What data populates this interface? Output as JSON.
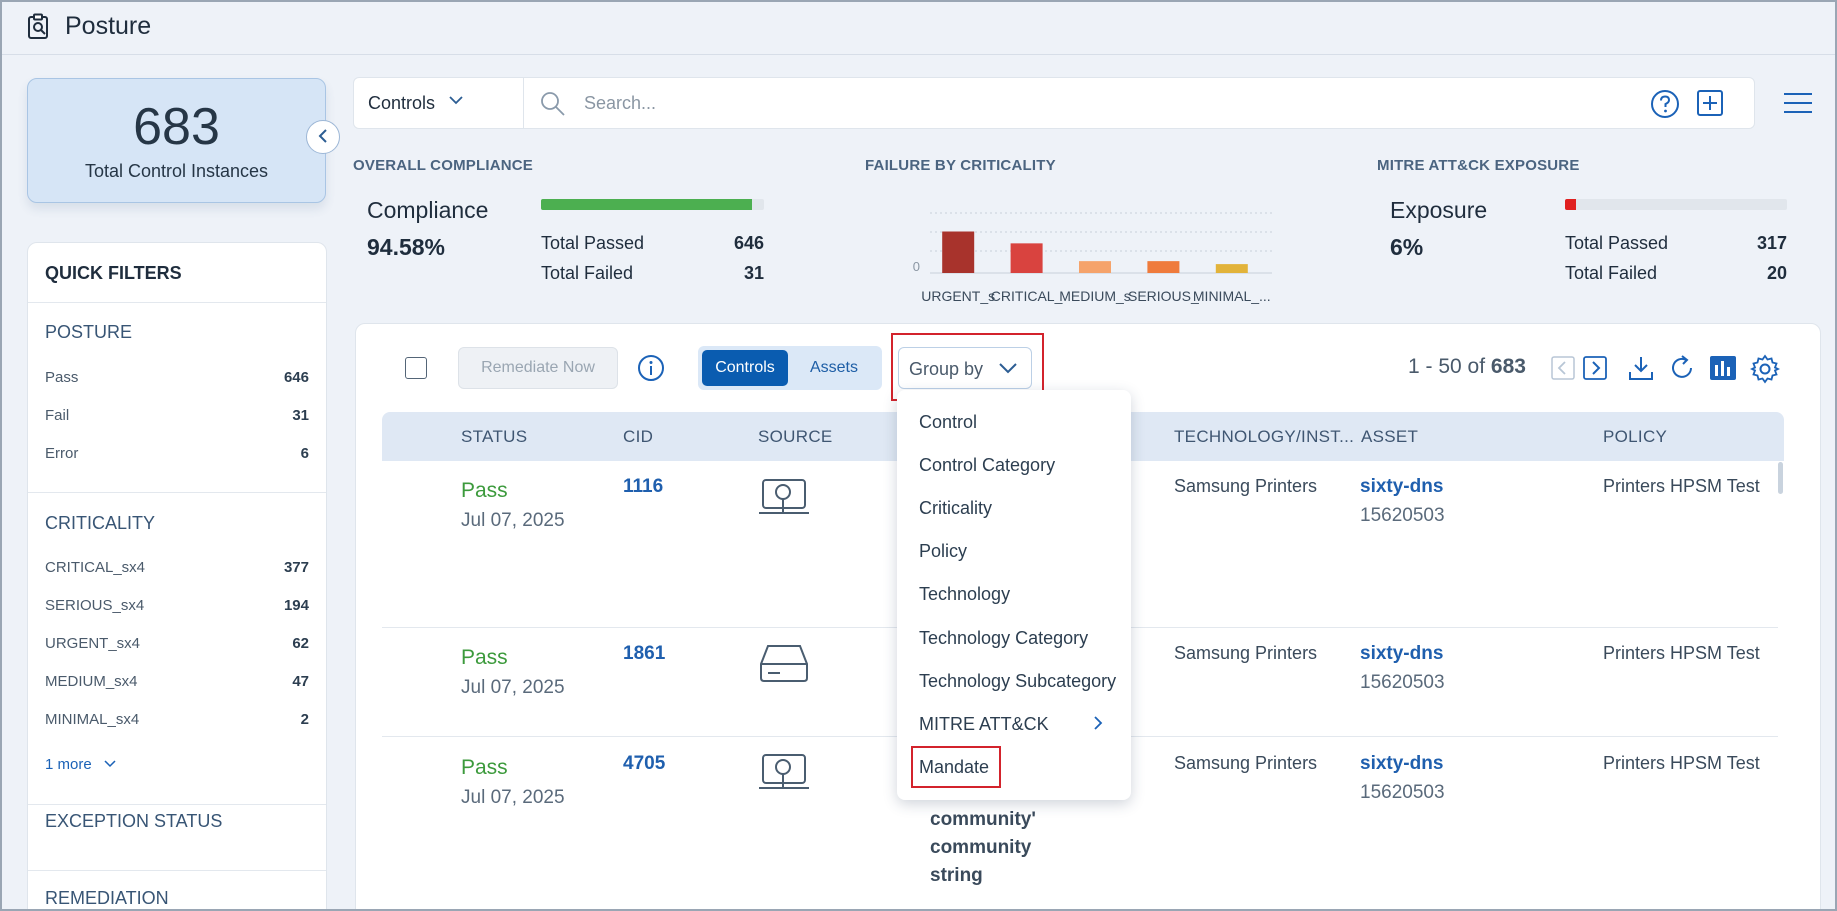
{
  "app": {
    "title": "Posture",
    "icon": "clipboard-search-icon"
  },
  "summary": {
    "total": "683",
    "label": "Total Control Instances"
  },
  "quick_filters": {
    "title": "QUICK FILTERS",
    "posture": {
      "title": "POSTURE",
      "items": [
        {
          "label": "Pass",
          "count": "646"
        },
        {
          "label": "Fail",
          "count": "31"
        },
        {
          "label": "Error",
          "count": "6"
        }
      ]
    },
    "criticality": {
      "title": "CRITICALITY",
      "items": [
        {
          "label": "CRITICAL_sx4",
          "count": "377"
        },
        {
          "label": "SERIOUS_sx4",
          "count": "194"
        },
        {
          "label": "URGENT_sx4",
          "count": "62"
        },
        {
          "label": "MEDIUM_sx4",
          "count": "47"
        },
        {
          "label": "MINIMAL_sx4",
          "count": "2"
        }
      ],
      "more": "1 more"
    },
    "exception_status": "EXCEPTION STATUS",
    "remediation": "REMEDIATION"
  },
  "search": {
    "scope": "Controls",
    "placeholder": "Search..."
  },
  "compliance": {
    "heading": "OVERALL COMPLIANCE",
    "label": "Compliance",
    "value": "94.58%",
    "progress": 0.9458,
    "passed_label": "Total Passed",
    "passed": "646",
    "failed_label": "Total Failed",
    "failed": "31",
    "color": "#4caf50"
  },
  "criticality_chart": {
    "heading": "FAILURE BY CRITICALITY",
    "y_tick": "0",
    "chart_data": {
      "type": "bar",
      "categories": [
        "URGENT_s",
        "CRITICAL_",
        "MEDIUM_s",
        "SERIOUS_",
        "MINIMAL_..."
      ],
      "values": [
        14,
        10,
        4,
        4,
        3
      ],
      "colors": [
        "#a8332c",
        "#d9433f",
        "#f5a36b",
        "#ef7b3c",
        "#e2b33a"
      ]
    }
  },
  "mitre": {
    "heading": "MITRE ATT&CK EXPOSURE",
    "label": "Exposure",
    "value": "6%",
    "progress": 0.06,
    "passed_label": "Total Passed",
    "passed": "317",
    "failed_label": "Total Failed",
    "failed": "20",
    "color": "#e02020"
  },
  "toolbar": {
    "remediate": "Remediate Now",
    "toggle": [
      "Controls",
      "Assets"
    ],
    "groupby": "Group by",
    "pager_range": "1 - 50 of",
    "pager_total": "683"
  },
  "table": {
    "headers": [
      "STATUS",
      "CID",
      "SOURCE",
      "TECHNOLOGY/INST...",
      "ASSET",
      "POLICY"
    ],
    "rows": [
      {
        "status": "Pass",
        "date": "Jul 07, 2025",
        "cid": "1116",
        "source_icon": "laptop-search-icon",
        "tech": "Samsung Printers",
        "asset": "sixty-dns",
        "asset_id": "15620503",
        "policy": "Printers HPSM Test"
      },
      {
        "status": "Pass",
        "date": "Jul 07, 2025",
        "cid": "1861",
        "source_icon": "hard-drive-icon",
        "tech": "Samsung Printers",
        "asset": "sixty-dns",
        "asset_id": "15620503",
        "policy": "Printers HPSM Test"
      },
      {
        "status": "Pass",
        "date": "Jul 07, 2025",
        "cid": "4705",
        "source_icon": "laptop-search-icon",
        "tech": "Samsung Printers",
        "asset": "sixty-dns",
        "asset_id": "15620503",
        "policy": "Printers HPSM Test",
        "control_title": [
          "community'",
          "community",
          "string"
        ]
      }
    ]
  },
  "groupby_menu": [
    "Control",
    "Control Category",
    "Criticality",
    "Policy",
    "Technology",
    "Technology Category",
    "Technology Subcategory",
    "MITRE ATT&CK",
    "Mandate"
  ]
}
